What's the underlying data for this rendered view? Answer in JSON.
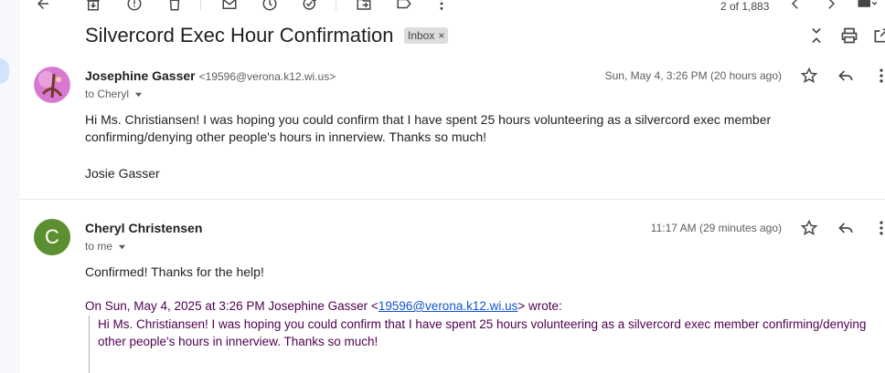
{
  "toolbar": {
    "count": "2 of 1,883"
  },
  "subject": {
    "title": "Silvercord Exec Hour Confirmation",
    "label": "Inbox",
    "label_close": "×"
  },
  "messages": [
    {
      "sender": "Josephine Gasser",
      "email": "<19596@verona.k12.wi.us>",
      "to": "to Cheryl",
      "date": "Sun, May 4, 3:26 PM (20 hours ago)",
      "body": "Hi Ms. Christiansen! I was hoping you could confirm that I have spent 25 hours volunteering as a silvercord exec member confirming/denying other people's hours in innerview. Thanks so much!",
      "signature": "Josie Gasser"
    },
    {
      "sender": "Cheryl Christensen",
      "avatar_letter": "C",
      "to": "to me",
      "date": "11:17 AM (29 minutes ago)",
      "body": "Confirmed!  Thanks for the help!",
      "quote_prefix": "On Sun, May 4, 2025 at 3:26 PM Josephine Gasser <",
      "quote_email": "19596@verona.k12.wi.us",
      "quote_suffix": "> wrote:",
      "quote_body": "Hi Ms. Christiansen! I was hoping you could confirm that I have spent 25 hours volunteering as a silvercord exec member confirming/denying other people's hours in innerview. Thanks so much!"
    }
  ],
  "colors": {
    "accent": "#1155cc",
    "quote": "#500050",
    "avatar_c": "#5b8f2f"
  }
}
